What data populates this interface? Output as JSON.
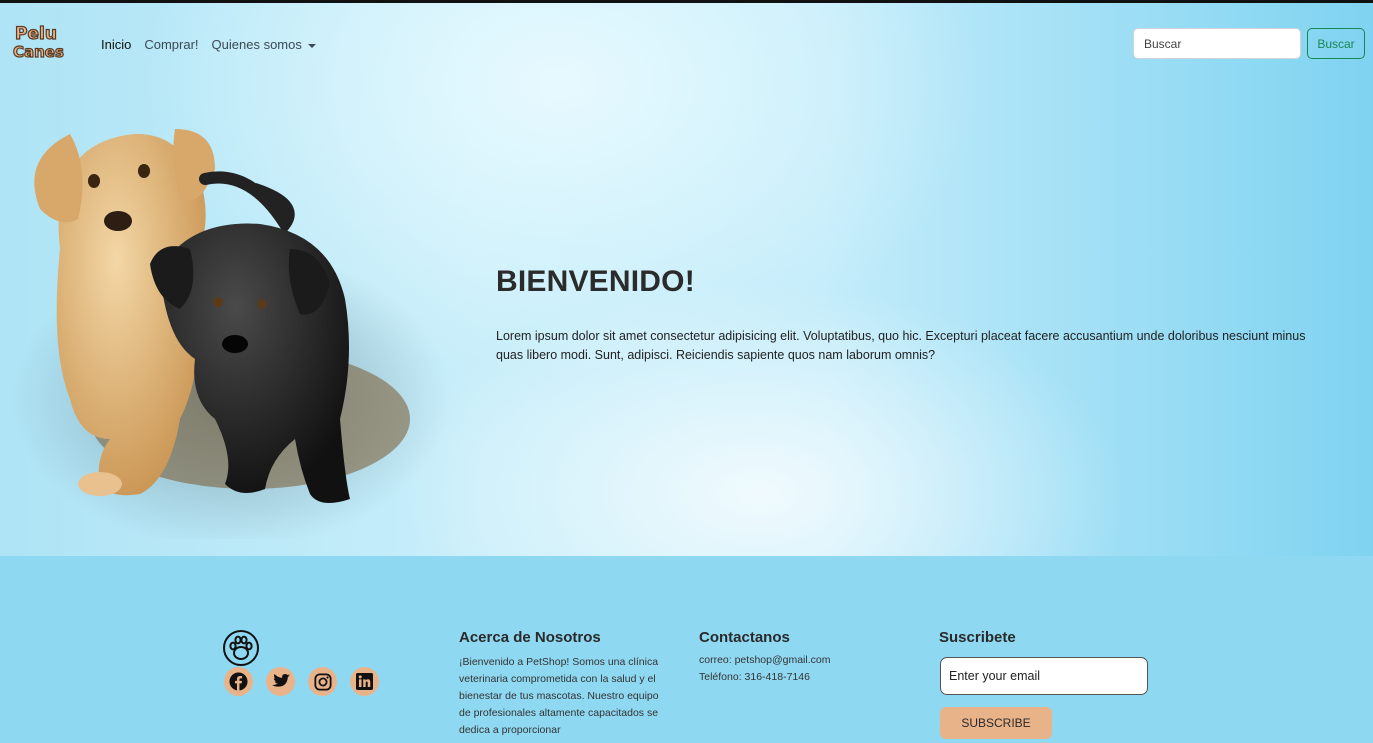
{
  "brand": {
    "logo_text_line1": "Pelu",
    "logo_text_line2": "Canes"
  },
  "nav": {
    "items": [
      {
        "label": "Inicio",
        "active": true
      },
      {
        "label": "Comprar!",
        "active": false
      },
      {
        "label": "Quienes somos",
        "active": false,
        "dropdown": true
      }
    ]
  },
  "search": {
    "placeholder": "Buscar",
    "button_label": "Buscar"
  },
  "hero": {
    "title": "BIENVENIDO!",
    "text": "Lorem ipsum dolor sit amet consectetur adipisicing elit. Voluptatibus, quo hic. Excepturi placeat facere accusantium unde doloribus nesciunt minus quas libero modi. Sunt, adipisci. Reiciendis sapiente quos nam laborum omnis?"
  },
  "footer": {
    "socials": [
      "facebook-icon",
      "twitter-icon",
      "instagram-icon",
      "linkedin-icon"
    ],
    "about": {
      "title": "Acerca de Nosotros",
      "text": "¡Bienvenido a PetShop! Somos una clínica veterinaria comprometida con la salud y el bienestar de tus mascotas. Nuestro equipo de profesionales altamente capacitados se dedica a proporcionar"
    },
    "contact": {
      "title": "Contactanos",
      "email": "correo: petshop@gmail.com",
      "phone": "Teléfono: 316-418-7146"
    },
    "subscribe": {
      "title": "Suscribete",
      "placeholder": "Enter your email",
      "button_label": "SUBSCRIBE"
    }
  },
  "colors": {
    "accent": "#e9b38a",
    "success": "#198754",
    "footer_bg": "#8fd8f2"
  }
}
